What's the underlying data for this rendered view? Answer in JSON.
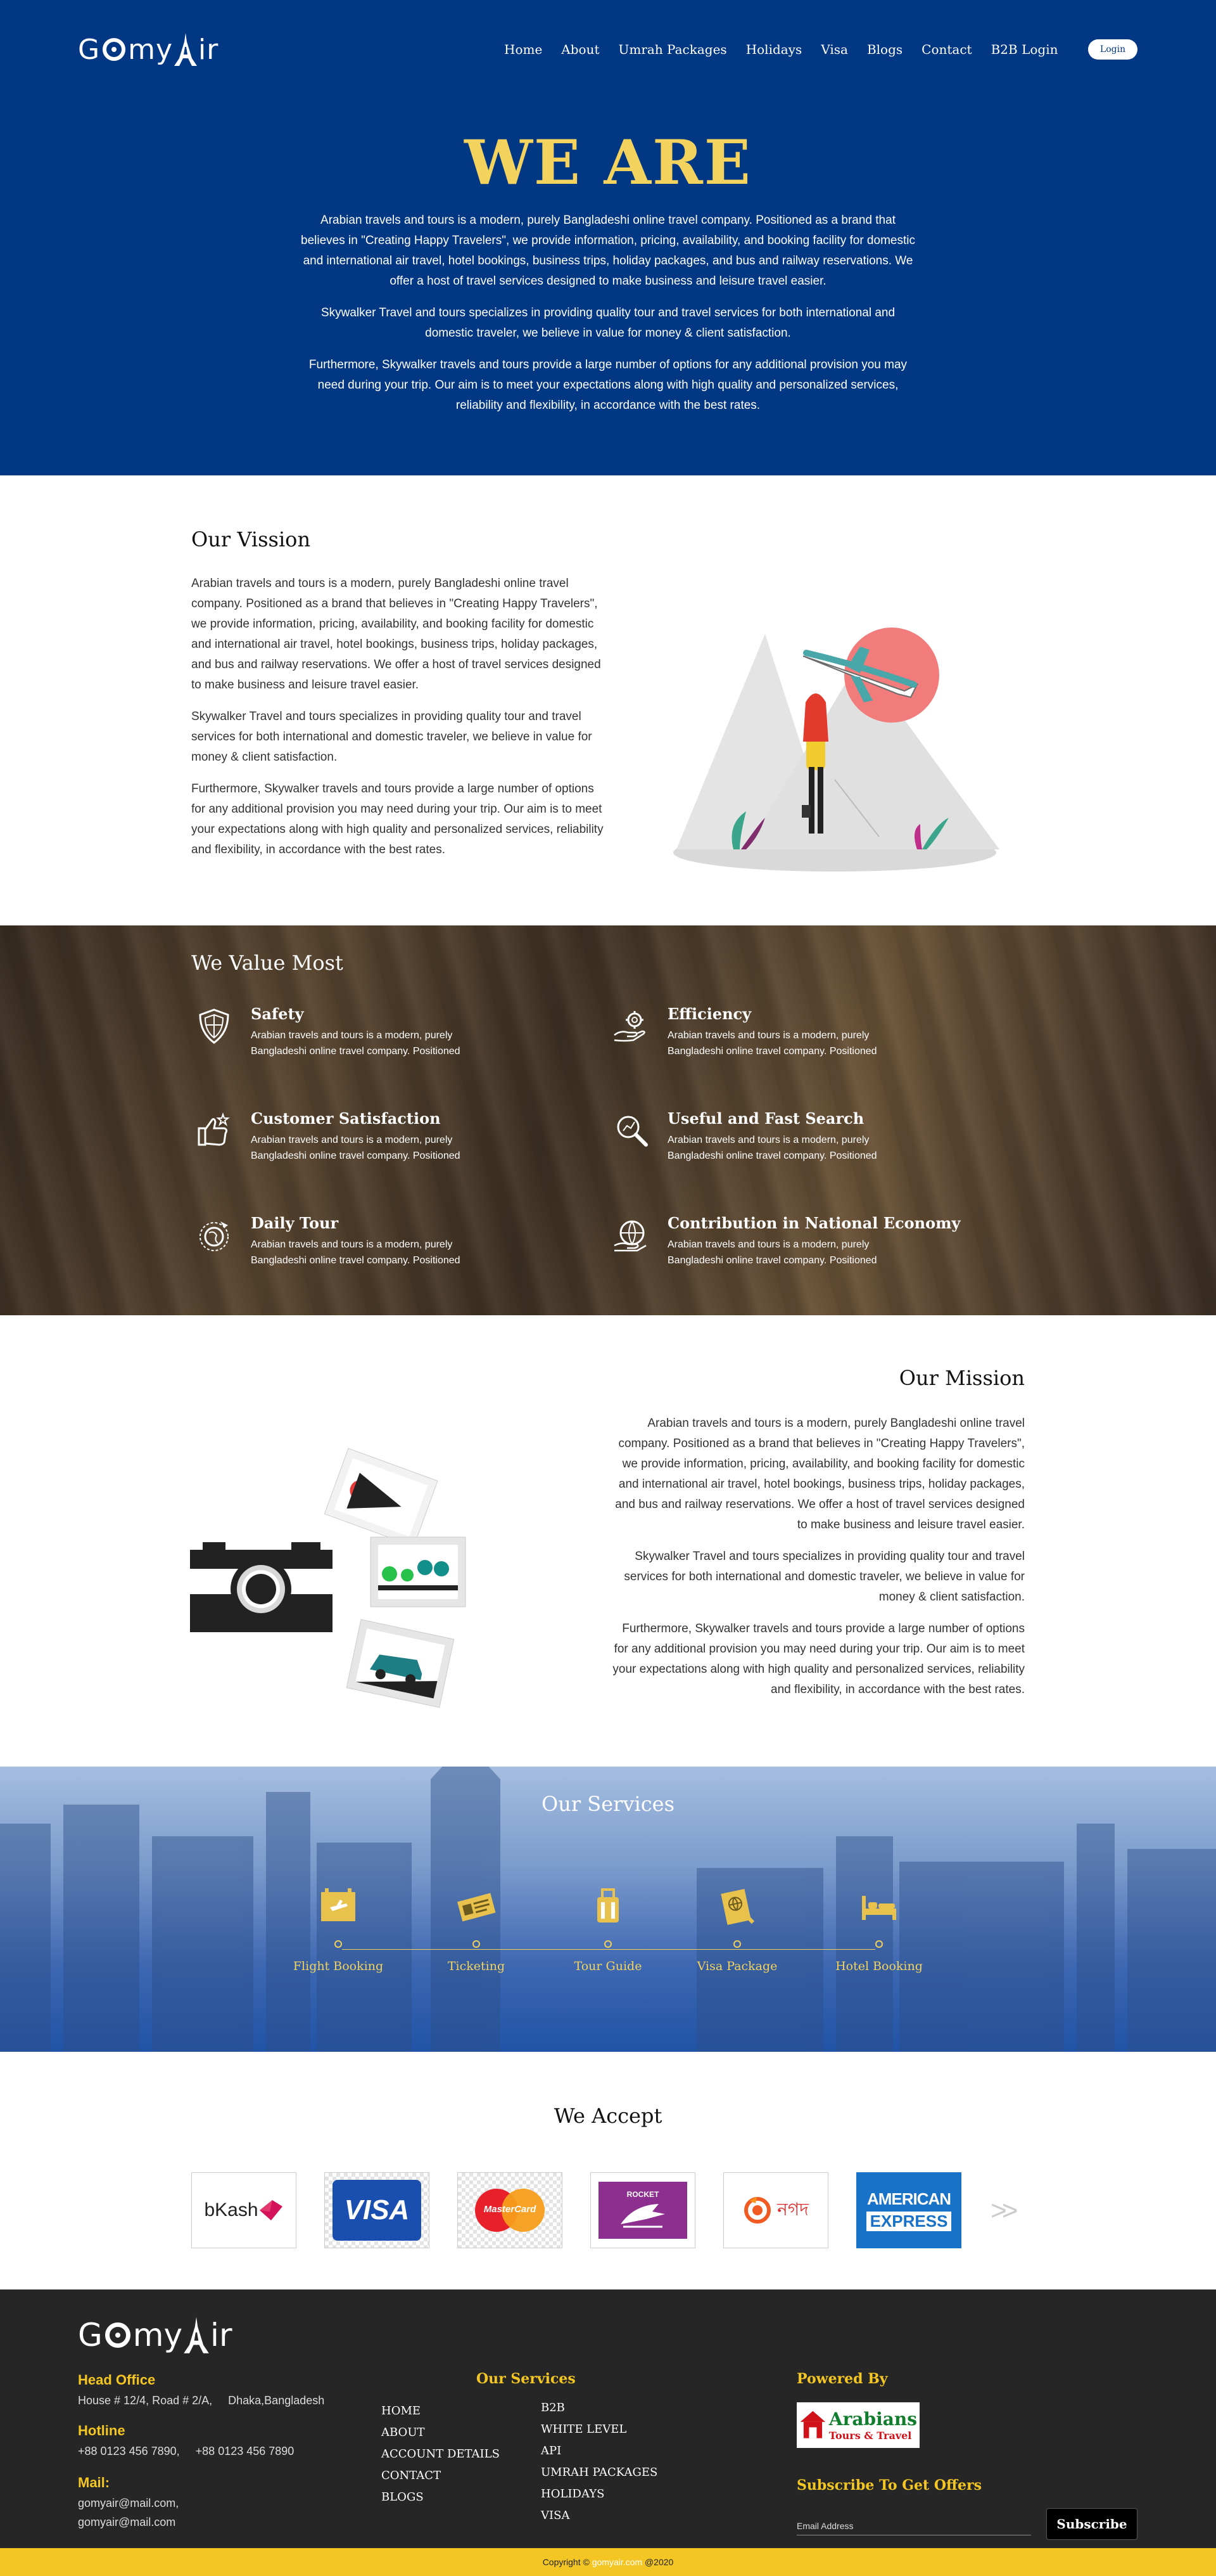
{
  "header": {
    "logo_text_1": "G",
    "logo_text_2": "my",
    "logo_text_3": "ir",
    "nav": [
      "Home",
      "About",
      "Umrah Packages",
      "Holidays",
      "Visa",
      "Blogs",
      "Contact",
      "B2B Login"
    ],
    "login_label": "Login"
  },
  "hero": {
    "title": "WE ARE",
    "paragraphs": [
      "Arabian travels and tours is a modern, purely Bangladeshi online travel company. Positioned as a brand that believes in \"Creating Happy Travelers\", we provide information, pricing, availability, and booking facility for domestic and international air travel, hotel bookings, business trips, holiday packages, and bus and railway reservations. We offer a host of travel services designed to make business and leisure travel easier.",
      "Skywalker Travel and tours specializes in providing quality tour and travel services for both international and domestic traveler, we believe in value for money & client satisfaction.",
      "Furthermore, Skywalker travels and tours provide a large number of options for any additional provision you may need during your trip. Our aim is to meet your expectations along with high quality and personalized services, reliability and flexibility, in accordance with the best rates."
    ]
  },
  "vision": {
    "title": "Our Vission",
    "paragraphs": [
      "Arabian travels and tours is a modern, purely Bangladeshi online travel company. Positioned as a brand that believes in \"Creating Happy Travelers\", we provide information, pricing, availability, and booking facility for domestic and international air travel, hotel bookings, business trips, holiday packages, and bus and railway reservations. We offer a host of travel services designed to make business and leisure travel easier.",
      "Skywalker Travel and tours specializes in providing quality tour and travel services for both international and domestic traveler, we believe in value for money & client satisfaction.",
      "Furthermore, Skywalker travels and tours provide a large number of options for any additional provision you may need during your trip. Our aim is to meet your expectations along with high quality and personalized services, reliability and flexibility, in accordance with the best rates."
    ]
  },
  "values": {
    "title": "We Value Most",
    "items": [
      {
        "title": "Safety",
        "text": "Arabian travels and tours is a modern, purely Bangladeshi online travel company. Positioned",
        "icon": "shield-icon"
      },
      {
        "title": "Efficiency",
        "text": "Arabian travels and tours is a modern, purely Bangladeshi online travel company. Positioned",
        "icon": "gear-hand-icon"
      },
      {
        "title": "Customer Satisfaction",
        "text": "Arabian travels and tours is a modern, purely Bangladeshi online travel company. Positioned",
        "icon": "thumbs-up-icon"
      },
      {
        "title": "Useful and Fast Search",
        "text": "Arabian travels and tours is a modern, purely Bangladeshi online travel company. Positioned",
        "icon": "magnifier-icon"
      },
      {
        "title": "Daily Tour",
        "text": "Arabian travels and tours is a modern, purely Bangladeshi online travel company. Positioned",
        "icon": "globe-plane-icon"
      },
      {
        "title": "Contribution in National Economy",
        "text": "Arabian travels and tours is a modern, purely Bangladeshi online travel company. Positioned",
        "icon": "globe-hand-icon"
      }
    ]
  },
  "mission": {
    "title": "Our Mission",
    "paragraphs": [
      "Arabian travels and tours is a modern, purely Bangladeshi online travel company. Positioned as a brand that believes in \"Creating Happy Travelers\", we provide information, pricing, availability, and booking facility for domestic and international air travel, hotel bookings, business trips, holiday packages, and bus and railway reservations. We offer a host of travel services designed to make business and leisure travel easier.",
      "Skywalker Travel and tours specializes in providing quality tour and travel services for both international and domestic traveler, we believe in value for money & client satisfaction.",
      "Furthermore, Skywalker travels and tours provide a large number of options for any additional provision you may need during your trip. Our aim is to meet your expectations along with high quality and personalized services, reliability and flexibility, in accordance with the best rates."
    ]
  },
  "services": {
    "title": "Our Services",
    "items": [
      {
        "label": "Flight Booking",
        "icon": "flight-board-icon"
      },
      {
        "label": "Ticketing",
        "icon": "ticket-icon"
      },
      {
        "label": "Tour Guide",
        "icon": "luggage-icon"
      },
      {
        "label": "Visa Package",
        "icon": "passport-icon"
      },
      {
        "label": "Hotel Booking",
        "icon": "bed-icon"
      }
    ]
  },
  "accept": {
    "title": "We Accept",
    "cards": [
      {
        "name": "bKash",
        "icon": "bkash-logo"
      },
      {
        "name": "VISA",
        "icon": "visa-logo"
      },
      {
        "name": "MasterCard",
        "icon": "mastercard-logo"
      },
      {
        "name": "ROCKET",
        "icon": "rocket-logo"
      },
      {
        "name": "নগদ",
        "icon": "nagad-logo"
      },
      {
        "name_1": "AMERICAN",
        "name_2": "EXPRESS",
        "icon": "amex-logo"
      }
    ],
    "next_label": ">>"
  },
  "footer": {
    "head_office_label": "Head Office",
    "address": "House # 12/4, Road # 2/A,     Dhaka,Bangladesh",
    "hotline_label": "Hotline",
    "hotline": "+88 0123 456 7890,     +88 0123 456 7890",
    "mail_label": "Mail:",
    "mail_1": "gomyair@mail.com,",
    "mail_2": "gomyair@mail.com",
    "links_left": [
      "HOME",
      "ABOUT",
      "ACCOUNT DETAILS",
      "CONTACT",
      "BLOGS"
    ],
    "services_label": "Our Services",
    "links_right": [
      "B2B",
      "WHITE LEVEL",
      "API",
      "UMRAH PACKAGES",
      "HOLIDAYS",
      "VISA"
    ],
    "powered_label": "Powered By",
    "powered_logo_1": "Arabians",
    "powered_logo_2": "Tours & Travel",
    "subscribe_label": "Subscribe To Get Offers",
    "email_placeholder": "Email Address",
    "subscribe_button": "Subscribe",
    "copyright_1": "Copyright ©",
    "copyright_brand": "gomyair.com",
    "copyright_2": "@2020"
  },
  "colors": {
    "hero_bg": "#023883",
    "accent_yellow": "#f3d35e",
    "footer_bg": "#262626",
    "copyright_bg": "#f3c623"
  }
}
